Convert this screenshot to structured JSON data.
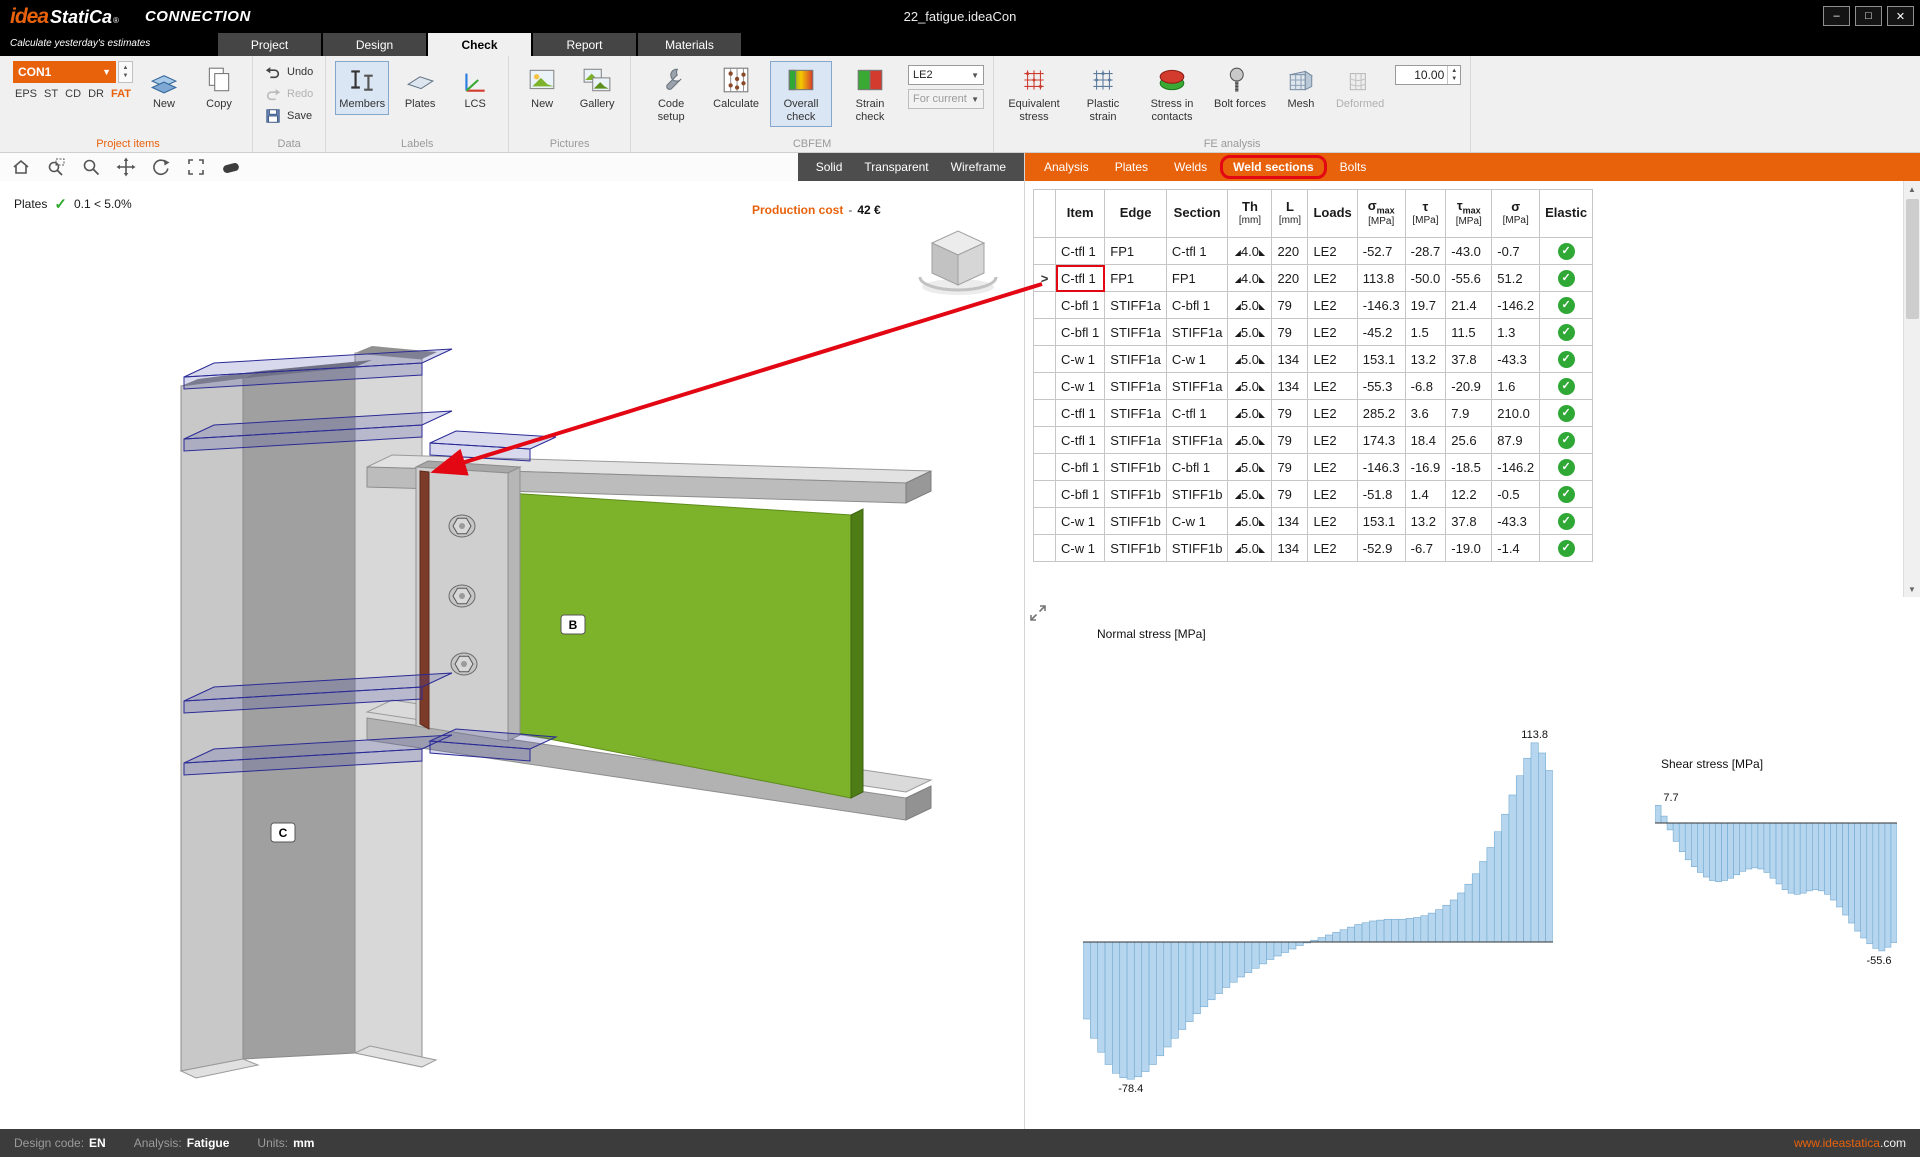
{
  "titlebar": {
    "logo_primary": "idea",
    "logo_secondary": "StatiCa",
    "logo_reg": "®",
    "app_name": "CONNECTION",
    "tagline": "Calculate yesterday's estimates",
    "document_title": "22_fatigue.ideaCon",
    "window_controls": {
      "minimize": "–",
      "maximize": "□",
      "close": "✕"
    }
  },
  "main_tabs": {
    "items": [
      "Project",
      "Design",
      "Check",
      "Report",
      "Materials"
    ],
    "active": "Check"
  },
  "ribbon": {
    "project_items": {
      "group_label": "Project items",
      "selector_value": "CON1",
      "modes": [
        "EPS",
        "ST",
        "CD",
        "DR",
        "FAT"
      ],
      "active_mode": "FAT",
      "new_label": "New",
      "copy_label": "Copy"
    },
    "data_group": {
      "group_label": "Data",
      "undo_label": "Undo",
      "redo_label": "Redo",
      "save_label": "Save"
    },
    "labels_group": {
      "group_label": "Labels",
      "members_label": "Members",
      "plates_label": "Plates",
      "lcs_label": "LCS"
    },
    "pictures_group": {
      "group_label": "Pictures",
      "new_label": "New",
      "gallery_label": "Gallery"
    },
    "cbfem_group": {
      "group_label": "CBFEM",
      "code_setup_label": "Code setup",
      "calculate_label": "Calculate",
      "overall_check_label": "Overall check",
      "strain_check_label": "Strain check",
      "load_case_value": "LE2",
      "loads_filter_value": "For current"
    },
    "fe_analysis_group": {
      "group_label": "FE analysis",
      "equivalent_stress_label": "Equivalent stress",
      "plastic_strain_label": "Plastic strain",
      "stress_in_contacts_label": "Stress in contacts",
      "bolt_forces_label": "Bolt forces",
      "mesh_label": "Mesh",
      "deformed_label": "Deformed",
      "scale_value": "10.00"
    }
  },
  "viewport": {
    "toolbar_icons": [
      "home",
      "zoom-window",
      "zoom",
      "pan",
      "rotate",
      "zoom-all",
      "clipping"
    ],
    "view_mode_buttons": [
      "Solid",
      "Transparent",
      "Wireframe"
    ],
    "plates_check": {
      "label": "Plates",
      "value": "0.1 < 5.0%"
    },
    "production_cost": {
      "label": "Production cost",
      "separator": "-",
      "value": "42 €"
    },
    "beam_label": "B",
    "column_label": "C"
  },
  "results_panel": {
    "tabs": [
      "Analysis",
      "Plates",
      "Welds",
      "Weld sections",
      "Bolts"
    ],
    "active_tab": "Weld sections",
    "table": {
      "columns": [
        {
          "label": "Item",
          "subscript": "",
          "unit": ""
        },
        {
          "label": "Edge",
          "subscript": "",
          "unit": ""
        },
        {
          "label": "Section",
          "subscript": "",
          "unit": ""
        },
        {
          "label": "Th",
          "subscript": "",
          "unit": "[mm]"
        },
        {
          "label": "L",
          "subscript": "",
          "unit": "[mm]"
        },
        {
          "label": "Loads",
          "subscript": "",
          "unit": ""
        },
        {
          "label": "σ",
          "subscript": "max",
          "unit": "[MPa]"
        },
        {
          "label": "τ",
          "subscript": "",
          "unit": "[MPa]"
        },
        {
          "label": "τ",
          "subscript": "max",
          "unit": "[MPa]"
        },
        {
          "label": "σ",
          "subscript": "",
          "unit": "[MPa]"
        },
        {
          "label": "Elastic",
          "subscript": "",
          "unit": ""
        }
      ],
      "selected_row": 1,
      "rows": [
        {
          "item": "C-tfl 1",
          "edge": "FP1",
          "section": "C-tfl 1",
          "th": "4.0",
          "l": "220",
          "loads": "LE2",
          "sigma_max": "-52.7",
          "tau": "-28.7",
          "tau_max": "-43.0",
          "sigma": "-0.7",
          "status": "ok"
        },
        {
          "item": "C-tfl 1",
          "edge": "FP1",
          "section": "FP1",
          "th": "4.0",
          "l": "220",
          "loads": "LE2",
          "sigma_max": "113.8",
          "tau": "-50.0",
          "tau_max": "-55.6",
          "sigma": "51.2",
          "status": "ok"
        },
        {
          "item": "C-bfl 1",
          "edge": "STIFF1a",
          "section": "C-bfl 1",
          "th": "5.0",
          "l": "79",
          "loads": "LE2",
          "sigma_max": "-146.3",
          "tau": "19.7",
          "tau_max": "21.4",
          "sigma": "-146.2",
          "status": "ok"
        },
        {
          "item": "C-bfl 1",
          "edge": "STIFF1a",
          "section": "STIFF1a",
          "th": "5.0",
          "l": "79",
          "loads": "LE2",
          "sigma_max": "-45.2",
          "tau": "1.5",
          "tau_max": "11.5",
          "sigma": "1.3",
          "status": "ok"
        },
        {
          "item": "C-w 1",
          "edge": "STIFF1a",
          "section": "C-w 1",
          "th": "5.0",
          "l": "134",
          "loads": "LE2",
          "sigma_max": "153.1",
          "tau": "13.2",
          "tau_max": "37.8",
          "sigma": "-43.3",
          "status": "ok"
        },
        {
          "item": "C-w 1",
          "edge": "STIFF1a",
          "section": "STIFF1a",
          "th": "5.0",
          "l": "134",
          "loads": "LE2",
          "sigma_max": "-55.3",
          "tau": "-6.8",
          "tau_max": "-20.9",
          "sigma": "1.6",
          "status": "ok"
        },
        {
          "item": "C-tfl 1",
          "edge": "STIFF1a",
          "section": "C-tfl 1",
          "th": "5.0",
          "l": "79",
          "loads": "LE2",
          "sigma_max": "285.2",
          "tau": "3.6",
          "tau_max": "7.9",
          "sigma": "210.0",
          "status": "ok"
        },
        {
          "item": "C-tfl 1",
          "edge": "STIFF1a",
          "section": "STIFF1a",
          "th": "5.0",
          "l": "79",
          "loads": "LE2",
          "sigma_max": "174.3",
          "tau": "18.4",
          "tau_max": "25.6",
          "sigma": "87.9",
          "status": "ok"
        },
        {
          "item": "C-bfl 1",
          "edge": "STIFF1b",
          "section": "C-bfl 1",
          "th": "5.0",
          "l": "79",
          "loads": "LE2",
          "sigma_max": "-146.3",
          "tau": "-16.9",
          "tau_max": "-18.5",
          "sigma": "-146.2",
          "status": "ok"
        },
        {
          "item": "C-bfl 1",
          "edge": "STIFF1b",
          "section": "STIFF1b",
          "th": "5.0",
          "l": "79",
          "loads": "LE2",
          "sigma_max": "-51.8",
          "tau": "1.4",
          "tau_max": "12.2",
          "sigma": "-0.5",
          "status": "ok"
        },
        {
          "item": "C-w 1",
          "edge": "STIFF1b",
          "section": "C-w 1",
          "th": "5.0",
          "l": "134",
          "loads": "LE2",
          "sigma_max": "153.1",
          "tau": "13.2",
          "tau_max": "37.8",
          "sigma": "-43.3",
          "status": "ok"
        },
        {
          "item": "C-w 1",
          "edge": "STIFF1b",
          "section": "STIFF1b",
          "th": "5.0",
          "l": "134",
          "loads": "LE2",
          "sigma_max": "-52.9",
          "tau": "-6.7",
          "tau_max": "-19.0",
          "sigma": "-1.4",
          "status": "ok"
        }
      ]
    }
  },
  "chart_data": [
    {
      "type": "bar",
      "title": "Normal stress [MPa]",
      "unit": "MPa",
      "max_label": "113.8",
      "min_label": "-78.4",
      "ylim": [
        -90,
        125
      ],
      "values": [
        -44,
        -55,
        -63,
        -70,
        -75,
        -77.5,
        -78.4,
        -77,
        -74,
        -70,
        -65,
        -60,
        -55,
        -50,
        -45.5,
        -41,
        -37,
        -33,
        -29.5,
        -26,
        -23,
        -20,
        -17.5,
        -15,
        -12.5,
        -10,
        -8,
        -6,
        -4,
        -2,
        -0.5,
        1,
        2.5,
        4,
        5.5,
        7,
        8.5,
        10,
        11,
        12,
        12.5,
        13,
        13,
        13,
        13.5,
        14,
        15,
        16.5,
        18.5,
        21,
        24,
        28,
        33,
        39,
        46,
        54,
        63,
        73,
        84,
        95,
        105,
        113.8,
        108,
        98
      ]
    },
    {
      "type": "bar",
      "title": "Shear stress [MPa]",
      "unit": "MPa",
      "max_label": "7.7",
      "min_label": "-55.6",
      "ylim": [
        -60,
        12
      ],
      "values": [
        7.7,
        3,
        -3,
        -8,
        -12.5,
        -16,
        -19,
        -21.5,
        -23.5,
        -25,
        -25.5,
        -25,
        -24,
        -22.5,
        -21,
        -20,
        -19.5,
        -20,
        -21.5,
        -24,
        -26.5,
        -29,
        -30.5,
        -31,
        -30.5,
        -29.5,
        -29,
        -29.5,
        -31,
        -33.5,
        -36.5,
        -40,
        -43.5,
        -47,
        -50,
        -52.5,
        -54.5,
        -55.6,
        -54,
        -52
      ]
    }
  ],
  "statusbar": {
    "design_code_label": "Design code:",
    "design_code_value": "EN",
    "analysis_label": "Analysis:",
    "analysis_value": "Fatigue",
    "units_label": "Units:",
    "units_value": "mm",
    "website": "www.ideastatica",
    "website_tld": ".com"
  },
  "icons": {
    "pass_check": "✓",
    "dropdown_arrow": "▼",
    "spinner_up": "▲",
    "spinner_down": "▼",
    "row_pointer": ">",
    "weld_left": "◢",
    "weld_right": "◣",
    "scroll_up": "▲",
    "scroll_down": "▼"
  },
  "colors": {
    "accent_orange": "#e8620c",
    "annotation_red": "#e30613",
    "check_green": "#2fa836",
    "chart_fill": "#b5d6ee",
    "weld_plate_green": "#7db32a"
  }
}
